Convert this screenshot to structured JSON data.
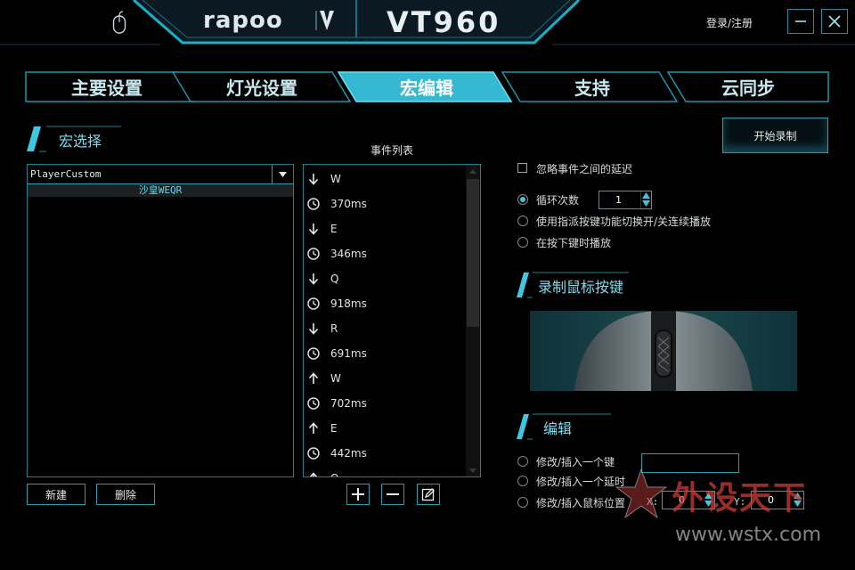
{
  "header": {
    "brand": "rapoo",
    "model": "VT960",
    "login_label": "登录/注册",
    "minimize_icon": "minimize-icon",
    "close_icon": "close-icon"
  },
  "tabs": [
    {
      "label": "主要设置",
      "active": false
    },
    {
      "label": "灯光设置",
      "active": false
    },
    {
      "label": "宏编辑",
      "active": true
    },
    {
      "label": "支持",
      "active": false
    },
    {
      "label": "云同步",
      "active": false
    }
  ],
  "macro_select": {
    "title": "宏选择",
    "selected_profile": "PlayerCustom",
    "macros": [
      "沙皇WEQR"
    ],
    "new_button": "新建",
    "delete_button": "删除"
  },
  "events": {
    "title": "事件列表",
    "items": [
      {
        "kind": "down",
        "text": "W"
      },
      {
        "kind": "delay",
        "text": "370ms"
      },
      {
        "kind": "down",
        "text": "E"
      },
      {
        "kind": "delay",
        "text": "346ms"
      },
      {
        "kind": "down",
        "text": "Q"
      },
      {
        "kind": "delay",
        "text": "918ms"
      },
      {
        "kind": "down",
        "text": "R"
      },
      {
        "kind": "delay",
        "text": "691ms"
      },
      {
        "kind": "up",
        "text": "W"
      },
      {
        "kind": "delay",
        "text": "702ms"
      },
      {
        "kind": "up",
        "text": "E"
      },
      {
        "kind": "delay",
        "text": "442ms"
      },
      {
        "kind": "up",
        "text": "Q"
      }
    ],
    "add_icon": "plus-icon",
    "remove_icon": "minus-icon",
    "edit_icon": "edit-icon"
  },
  "record": {
    "start_button": "开始录制",
    "ignore_delay_label": "忽略事件之间的延迟",
    "loop_label": "循环次数",
    "loop_count": "1",
    "toggle_play_label": "使用指派按键功能切换开/关连续播放",
    "hold_play_label": "在按下键时播放",
    "mouse_section_title": "录制鼠标按键"
  },
  "edit": {
    "title": "编辑",
    "modify_key_label": "修改/插入一个键",
    "modify_delay_label": "修改/插入一个延时",
    "modify_mouse_label": "修改/插入鼠标位置",
    "x_label": "X:",
    "x_value": "0",
    "y_label": "Y:",
    "y_value": "0"
  },
  "watermark": {
    "title": "外设天下",
    "url": "www.wstx.com"
  },
  "colors": {
    "accent": "#3fc6e0",
    "active_tab": "#3fbfd8",
    "border": "#1f7f92"
  }
}
